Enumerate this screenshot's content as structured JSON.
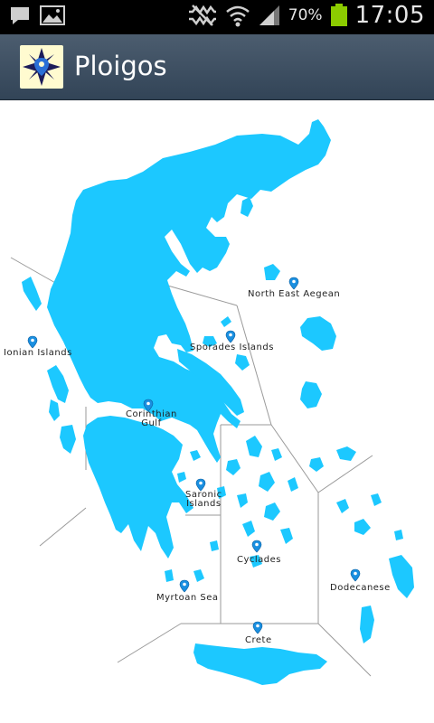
{
  "status_bar": {
    "battery_percent": "70%",
    "time": "17:05",
    "icons": [
      "chat-notification-icon",
      "gallery-notification-icon",
      "mute-icon",
      "wifi-icon",
      "signal-icon",
      "battery-icon"
    ],
    "battery_color": "#8ccc00"
  },
  "action_bar": {
    "title": "Ploigos",
    "icon": "compass-pin-logo"
  },
  "map": {
    "land_color": "#1cc8ff",
    "regions": [
      {
        "id": "north-east-aegean",
        "label": "North East Aegean"
      },
      {
        "id": "sporades-islands",
        "label": "Sporades Islands"
      },
      {
        "id": "ionian-islands",
        "label": "Ionian Islands"
      },
      {
        "id": "corinthian-gulf",
        "label_line1": "Corinthian",
        "label_line2": "Gulf"
      },
      {
        "id": "saronic-islands",
        "label_line1": "Saronic",
        "label_line2": "Islands"
      },
      {
        "id": "cyclades",
        "label": "Cyclades"
      },
      {
        "id": "dodecanese",
        "label": "Dodecanese"
      },
      {
        "id": "myrtoan-sea",
        "label": "Myrtoan Sea"
      },
      {
        "id": "crete",
        "label": "Crete"
      }
    ]
  }
}
